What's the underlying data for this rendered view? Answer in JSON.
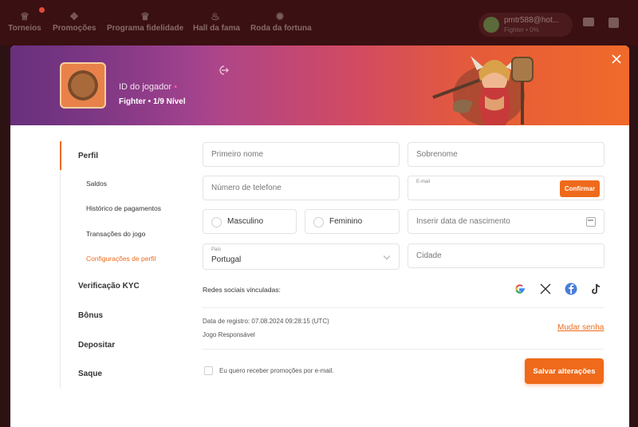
{
  "topnav": {
    "items": [
      {
        "label": "Torneios",
        "icon": "trophy-icon"
      },
      {
        "label": "Promoções",
        "icon": "gift-icon"
      },
      {
        "label": "Programa fidelidade",
        "icon": "crown-icon"
      },
      {
        "label": "Hall da fama",
        "icon": "flame-icon"
      },
      {
        "label": "Roda da fortuna",
        "icon": "wheel-icon"
      }
    ],
    "user": {
      "name": "pmtr588@hot...",
      "sub": "Fighter • 0%"
    }
  },
  "profile": {
    "player_id_label": "ID do jogador",
    "level_text": "Fighter • 1/9 Nível"
  },
  "sidebar": {
    "profile": "Perfil",
    "sub_items": [
      "Saldos",
      "Histórico de pagamentos",
      "Transações do jogo",
      "Configurações de perfil"
    ],
    "kyc": "Verificação KYC",
    "bonus": "Bônus",
    "deposit": "Depositar",
    "withdraw": "Saque"
  },
  "form": {
    "first_name_placeholder": "Primeiro nome",
    "last_name_placeholder": "Sobrenome",
    "phone_placeholder": "Número de telefone",
    "email_label": "E-mail",
    "confirm_label": "Confirmar",
    "male_label": "Masculino",
    "female_label": "Feminino",
    "birthdate_placeholder": "Inserir data de nascimento",
    "country_label": "País",
    "country_value": "Portugal",
    "city_placeholder": "Cidade"
  },
  "social": {
    "label": "Redes sociais vinculadas:",
    "icons": [
      "google-icon",
      "x-icon",
      "facebook-icon",
      "tiktok-icon"
    ]
  },
  "account": {
    "registration": "Data de registro: 07.08.2024 09:28:15 (UTC)",
    "responsible_gaming": "Jogo Responsável",
    "change_password": "Mudar senha"
  },
  "footer": {
    "promo_checkbox_label": "Eu quero receber promoções por e-mail.",
    "save_label": "Salvar alterações"
  },
  "colors": {
    "accent": "#ef6a1a"
  }
}
